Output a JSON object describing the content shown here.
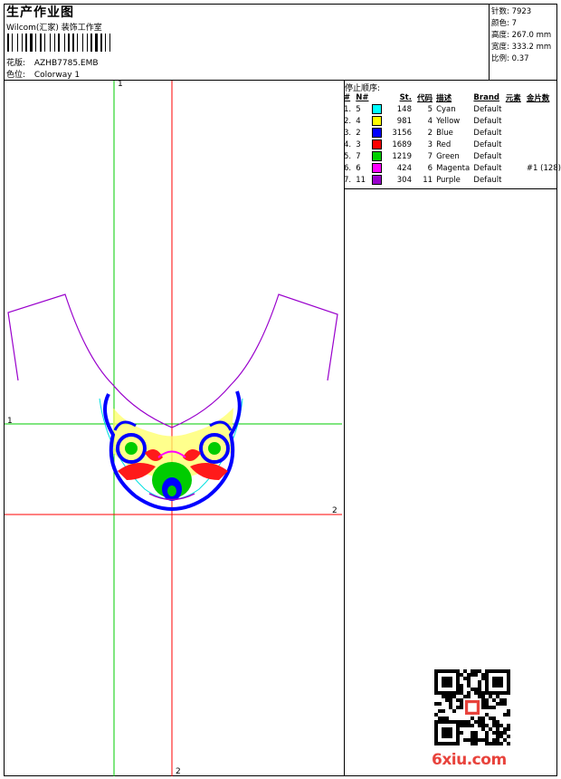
{
  "header": {
    "title": "生产作业图",
    "company": "Wilcom(汇家) 装饰工作室",
    "design_label": "花版:",
    "design_value": "AZHB7785.EMB",
    "colorway_label": "色位:",
    "colorway_value": "Colorway 1"
  },
  "info": {
    "stitches_label": "针数:",
    "stitches": "7923",
    "colors_label": "颜色:",
    "colors": "7",
    "height_label": "高度:",
    "height": "267.0 mm",
    "width_label": "宽度:",
    "width": "333.2 mm",
    "scale_label": "比例:",
    "scale": "0.37"
  },
  "stop_sequence": {
    "title": "停止顺序:",
    "columns": [
      "#",
      "N#",
      "St.",
      "代码",
      "描述",
      "Brand",
      "元素",
      "金片数"
    ],
    "rows": [
      {
        "idx": "1.",
        "n": "5",
        "color": "#00ffff",
        "st": "148",
        "code": "5",
        "desc": "Cyan",
        "brand": "Default",
        "extra": ""
      },
      {
        "idx": "2.",
        "n": "4",
        "color": "#ffff00",
        "st": "981",
        "code": "4",
        "desc": "Yellow",
        "brand": "Default",
        "extra": ""
      },
      {
        "idx": "3.",
        "n": "2",
        "color": "#0000ff",
        "st": "3156",
        "code": "2",
        "desc": "Blue",
        "brand": "Default",
        "extra": ""
      },
      {
        "idx": "4.",
        "n": "3",
        "color": "#ff0000",
        "st": "1689",
        "code": "3",
        "desc": "Red",
        "brand": "Default",
        "extra": ""
      },
      {
        "idx": "5.",
        "n": "7",
        "color": "#00d000",
        "st": "1219",
        "code": "7",
        "desc": "Green",
        "brand": "Default",
        "extra": ""
      },
      {
        "idx": "6.",
        "n": "6",
        "color": "#ff00ff",
        "st": "424",
        "code": "6",
        "desc": "Magenta",
        "brand": "Default",
        "extra": "#1 (128)"
      },
      {
        "idx": "7.",
        "n": "11",
        "color": "#9900cc",
        "st": "304",
        "code": "11",
        "desc": "Purple",
        "brand": "Default",
        "extra": ""
      }
    ]
  },
  "guides": {
    "v_green": "1",
    "h_green": "1",
    "h_red": "2",
    "v_red": "2"
  },
  "colors": {
    "green_guide": "#00cc00",
    "red_guide": "#ff0000",
    "outline": "#9900cc"
  },
  "watermark": "6xiu.com"
}
